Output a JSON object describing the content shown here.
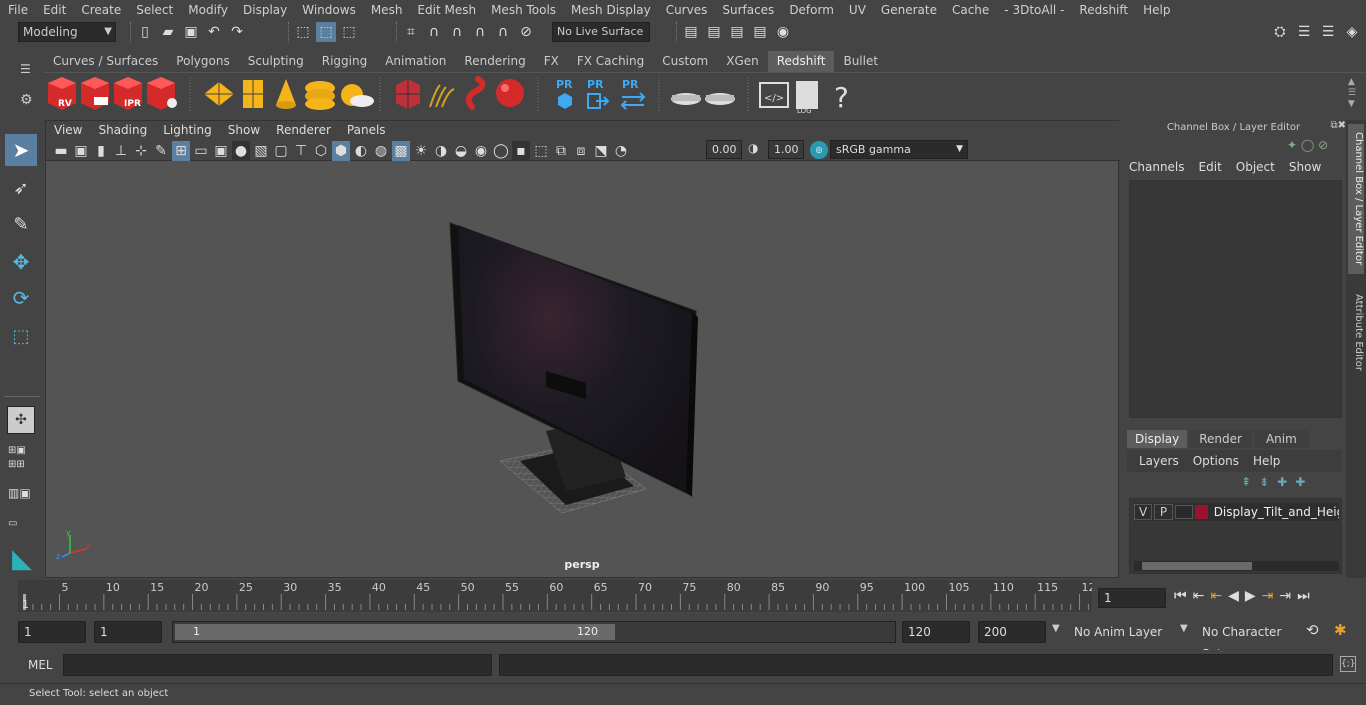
{
  "menubar": [
    "File",
    "Edit",
    "Create",
    "Select",
    "Modify",
    "Display",
    "Windows",
    "Mesh",
    "Edit Mesh",
    "Mesh Tools",
    "Mesh Display",
    "Curves",
    "Surfaces",
    "Deform",
    "UV",
    "Generate",
    "Cache",
    "- 3DtoAll -",
    "Redshift",
    "Help"
  ],
  "status": {
    "workspace": "Modeling",
    "live_surface": "No Live Surface"
  },
  "shelf_tabs": [
    "Curves / Surfaces",
    "Polygons",
    "Sculpting",
    "Rigging",
    "Animation",
    "Rendering",
    "FX",
    "FX Caching",
    "Custom",
    "XGen",
    "Redshift",
    "Bullet"
  ],
  "shelf_active": "Redshift",
  "shelf_icons": {
    "rv": "RV",
    "ipr": "IPR",
    "pr": "PR",
    "log": "LOG",
    "help": "?"
  },
  "viewport": {
    "menu": [
      "View",
      "Shading",
      "Lighting",
      "Show",
      "Renderer",
      "Panels"
    ],
    "near": "0.00",
    "far": "1.00",
    "colorspace": "sRGB gamma",
    "camera": "persp"
  },
  "channelbox": {
    "title": "Channel Box / Layer Editor",
    "menu": [
      "Channels",
      "Edit",
      "Object",
      "Show"
    ],
    "layer_tabs": [
      "Display",
      "Render",
      "Anim"
    ],
    "layer_menu": [
      "Layers",
      "Options",
      "Help"
    ],
    "layer": {
      "v": "V",
      "p": "P",
      "name": "Display_Tilt_and_Heigh",
      "color": "#9b1230"
    }
  },
  "side_tabs": [
    "Channel Box / Layer Editor",
    "Attribute Editor"
  ],
  "timeline": {
    "ticks": [
      "5",
      "10",
      "15",
      "20",
      "25",
      "30",
      "35",
      "40",
      "45",
      "50",
      "55",
      "60",
      "65",
      "70",
      "75",
      "80",
      "85",
      "90",
      "95",
      "100",
      "105",
      "110",
      "115",
      "12"
    ],
    "start_marker": "1",
    "current": "1"
  },
  "range": {
    "start": "1",
    "playback_start": "1",
    "slider_start": "1",
    "slider_end": "120",
    "playback_end": "120",
    "end": "200",
    "anim_layer": "No Anim Layer",
    "char_set": "No Character Set"
  },
  "cmd": {
    "label": "MEL"
  },
  "help_line": "Select Tool: select an object"
}
